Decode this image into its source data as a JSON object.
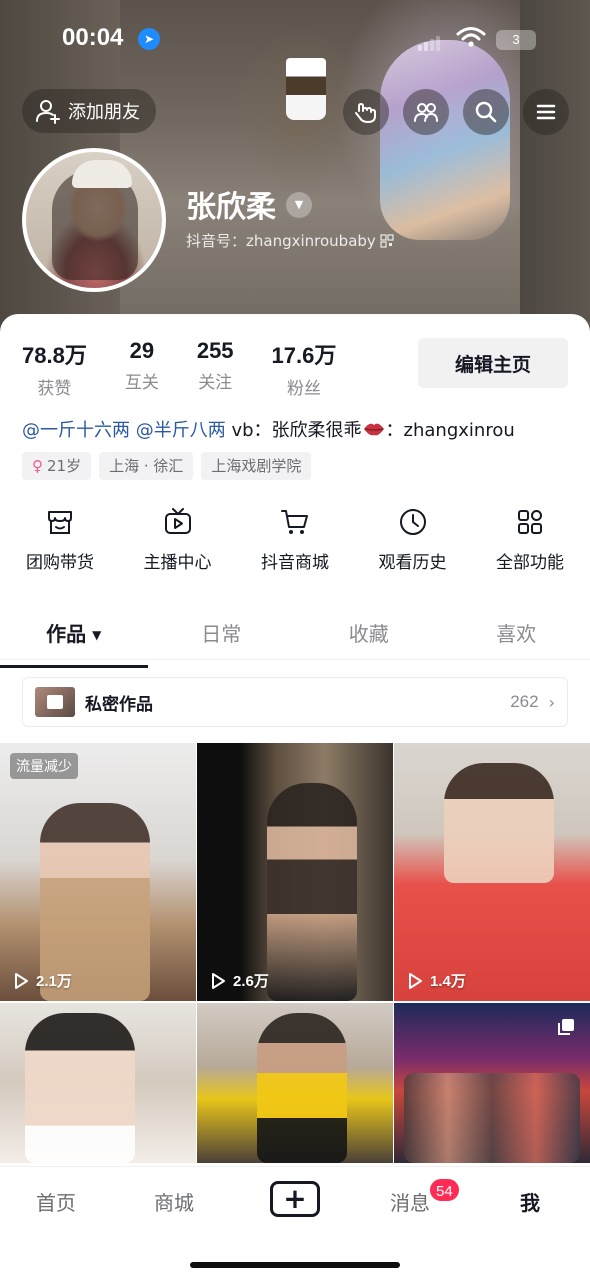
{
  "status_bar": {
    "time": "00:04",
    "battery": "3"
  },
  "header": {
    "add_friend_label": "添加朋友",
    "username": "张欣柔",
    "douyin_id": "抖音号：zhangxinroubaby"
  },
  "stats": [
    {
      "value": "78.8万",
      "label": "获赞"
    },
    {
      "value": "29",
      "label": "互关"
    },
    {
      "value": "255",
      "label": "关注"
    },
    {
      "value": "17.6万",
      "label": "粉丝"
    }
  ],
  "edit_profile_label": "编辑主页",
  "bio": {
    "mention1": "@一斤十六两",
    "mention2": "@半斤八两",
    "text1": "vb：张欣柔很乖",
    "text2": "：zhangxinrou"
  },
  "tags": {
    "age": "21岁",
    "location": "上海 · 徐汇",
    "school": "上海戏剧学院"
  },
  "quick_actions": [
    {
      "label": "团购带货",
      "icon": "shop-bag-icon"
    },
    {
      "label": "主播中心",
      "icon": "tv-play-icon"
    },
    {
      "label": "抖音商城",
      "icon": "cart-icon"
    },
    {
      "label": "观看历史",
      "icon": "clock-icon"
    },
    {
      "label": "全部功能",
      "icon": "grid-apps-icon"
    }
  ],
  "tabs": [
    "作品",
    "日常",
    "收藏",
    "喜欢"
  ],
  "private_works": {
    "title": "私密作品",
    "count": "262"
  },
  "videos": [
    {
      "views": "2.1万",
      "badge": "流量减少"
    },
    {
      "views": "2.6万"
    },
    {
      "views": "1.4万"
    },
    {},
    {},
    {}
  ],
  "bottom_nav": {
    "home": "首页",
    "mall": "商城",
    "plus": "+",
    "messages": "消息",
    "messages_badge": "54",
    "me": "我"
  },
  "colors": {
    "accent": "#fe2c55",
    "mention": "#2b5aa0",
    "text": "#161823",
    "secondary": "#8a8b91"
  }
}
